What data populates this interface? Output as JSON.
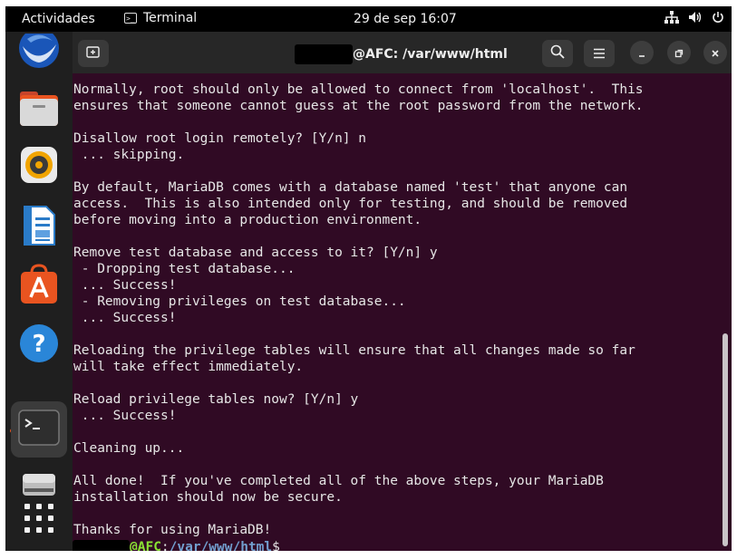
{
  "topbar": {
    "activities": "Actividades",
    "app_name": "Terminal",
    "clock": "29 de sep  16:07"
  },
  "dock": {
    "items": [
      {
        "name": "thunderbird"
      },
      {
        "name": "files"
      },
      {
        "name": "rhythmbox"
      },
      {
        "name": "libreoffice-writer"
      },
      {
        "name": "software"
      },
      {
        "name": "help"
      },
      {
        "name": "terminal",
        "active": true
      },
      {
        "name": "drive"
      },
      {
        "name": "show-apps"
      }
    ],
    "running_color": "#e95420"
  },
  "window": {
    "title_suffix": "@AFC: /var/www/html"
  },
  "terminal": {
    "output": "Normally, root should only be allowed to connect from 'localhost'.  This\nensures that someone cannot guess at the root password from the network.\n\nDisallow root login remotely? [Y/n] n\n ... skipping.\n\nBy default, MariaDB comes with a database named 'test' that anyone can\naccess.  This is also intended only for testing, and should be removed\nbefore moving into a production environment.\n\nRemove test database and access to it? [Y/n] y\n - Dropping test database...\n ... Success!\n - Removing privileges on test database...\n ... Success!\n\nReloading the privilege tables will ensure that all changes made so far\nwill take effect immediately.\n\nReload privilege tables now? [Y/n] y\n ... Success!\n\nCleaning up...\n\nAll done!  If you've completed all of the above steps, your MariaDB\ninstallation should now be secure.\n\nThanks for using MariaDB!",
    "prompt_host": "@AFC",
    "prompt_sep": ":",
    "prompt_path": "/var/www/html",
    "prompt_sign": "$",
    "background": "#300a24",
    "host_color": "#8ae234",
    "path_color": "#729fcf"
  }
}
